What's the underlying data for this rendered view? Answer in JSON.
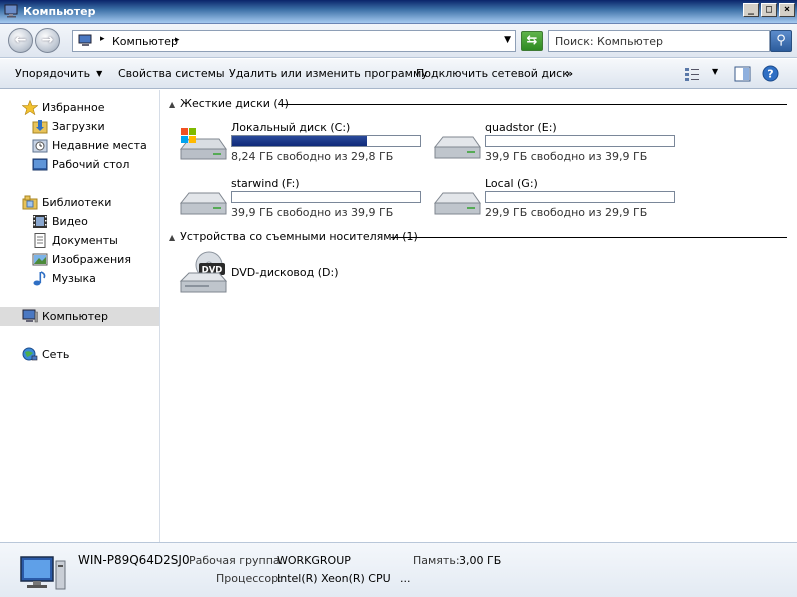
{
  "window": {
    "title": "Компьютер"
  },
  "address": {
    "crumb": "Компьютер",
    "search_placeholder": "Поиск: Компьютер"
  },
  "toolbar": {
    "organize": "Упорядочить",
    "system_properties": "Свойства системы",
    "uninstall": "Удалить или изменить программу",
    "map_drive": "Подключить сетевой диск",
    "more": "»"
  },
  "sidebar": {
    "favorites": "Избранное",
    "downloads": "Загрузки",
    "recent": "Недавние места",
    "desktop": "Рабочий стол",
    "libraries": "Библиотеки",
    "video": "Видео",
    "documents": "Документы",
    "images": "Изображения",
    "music": "Музыка",
    "computer": "Компьютер",
    "network": "Сеть"
  },
  "main": {
    "hdd_group": "Жесткие диски (4)",
    "removable_group": "Устройства со съемными носителями (1)",
    "drives": [
      {
        "name": "Локальный диск (C:)",
        "free": "8,24 ГБ свободно из 29,8 ГБ",
        "used_fraction": 0.72
      },
      {
        "name": "quadstor (E:)",
        "free": "39,9 ГБ свободно из 39,9 ГБ",
        "used_fraction": 0.0
      },
      {
        "name": "starwind (F:)",
        "free": "39,9 ГБ свободно из 39,9 ГБ",
        "used_fraction": 0.0
      },
      {
        "name": "Local (G:)",
        "free": "29,9 ГБ свободно из 29,9 ГБ",
        "used_fraction": 0.0
      }
    ],
    "dvd": {
      "name": "DVD-дисковод (D:)",
      "badge": "DVD"
    }
  },
  "details": {
    "computer_name": "WIN-P89Q64D2SJ0",
    "workgroup_label": "Рабочая группа:",
    "workgroup_value": "WORKGROUP",
    "memory_label": "Память:",
    "memory_value": "3,00 ГБ",
    "cpu_label": "Процессор:",
    "cpu_value": "Intel(R) Xeon(R) CPU",
    "cpu_more": "..."
  }
}
